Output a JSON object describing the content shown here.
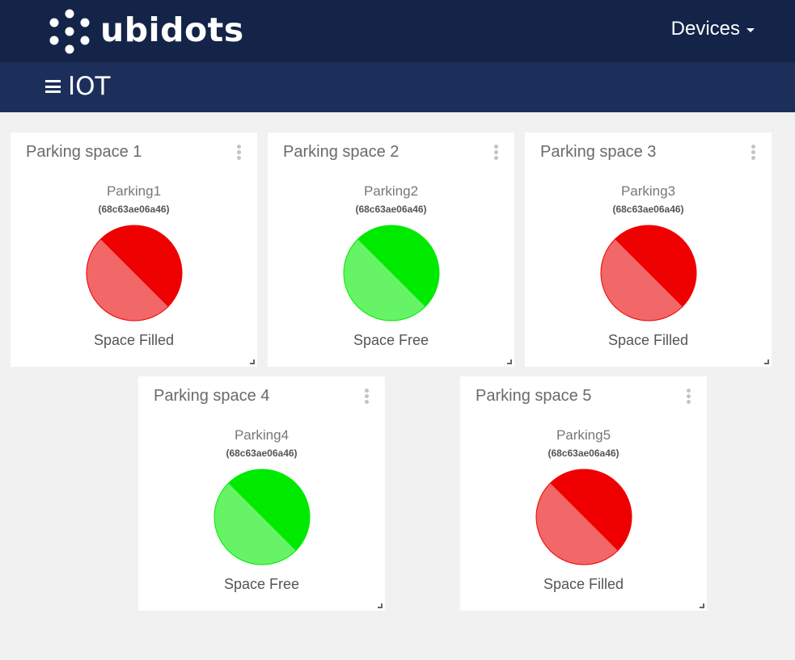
{
  "header": {
    "logo_text": "ubidots",
    "devices_label": "Devices"
  },
  "dashboard": {
    "title": "IOT"
  },
  "widgets": [
    {
      "title": "Parking space 1",
      "variable": "Parking1",
      "id": "(68c63ae06a46)",
      "status": "Space Filled",
      "state": "filled"
    },
    {
      "title": "Parking space 2",
      "variable": "Parking2",
      "id": "(68c63ae06a46)",
      "status": "Space Free",
      "state": "free"
    },
    {
      "title": "Parking space 3",
      "variable": "Parking3",
      "id": "(68c63ae06a46)",
      "status": "Space Filled",
      "state": "filled"
    },
    {
      "title": "Parking space 4",
      "variable": "Parking4",
      "id": "(68c63ae06a46)",
      "status": "Space Free",
      "state": "free"
    },
    {
      "title": "Parking space 5",
      "variable": "Parking5",
      "id": "(68c63ae06a46)",
      "status": "Space Filled",
      "state": "filled"
    }
  ],
  "colors": {
    "filled_dark": "#ee0000",
    "filled_light": "#f26767",
    "free_dark": "#00ea00",
    "free_light": "#66f366",
    "header_bg": "#142448",
    "subheader_bg": "#1c2f5b"
  }
}
